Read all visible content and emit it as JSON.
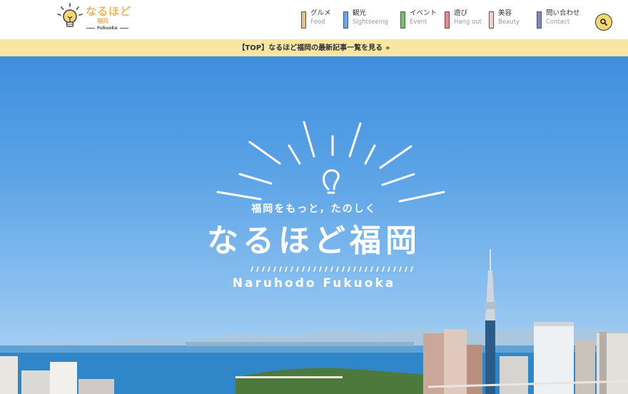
{
  "header": {
    "logo": {
      "title": "なるほど",
      "subtitle": "福岡",
      "english": "Fukuoka"
    },
    "nav": [
      {
        "jp": "グルメ",
        "en": "Food",
        "color": "#e9c27c"
      },
      {
        "jp": "観光",
        "en": "Sightseeing",
        "color": "#6ea6e0"
      },
      {
        "jp": "イベント",
        "en": "Event",
        "color": "#7dbb6f"
      },
      {
        "jp": "遊び",
        "en": "Hang out",
        "color": "#e58a8a"
      },
      {
        "jp": "美容",
        "en": "Beauty",
        "color": "#f2d0cf"
      },
      {
        "jp": "問い合わせ",
        "en": "Contact",
        "color": "#7d86c8"
      }
    ],
    "search_icon": "search-icon"
  },
  "banner": {
    "text": "【TOP】なるほど福岡の最新記事一覧を見る",
    "chevron": "»"
  },
  "hero": {
    "tagline": "福岡をもっと，たのしく",
    "title": "なるほど福岡",
    "title_en": "Naruhodo Fukuoka"
  }
}
